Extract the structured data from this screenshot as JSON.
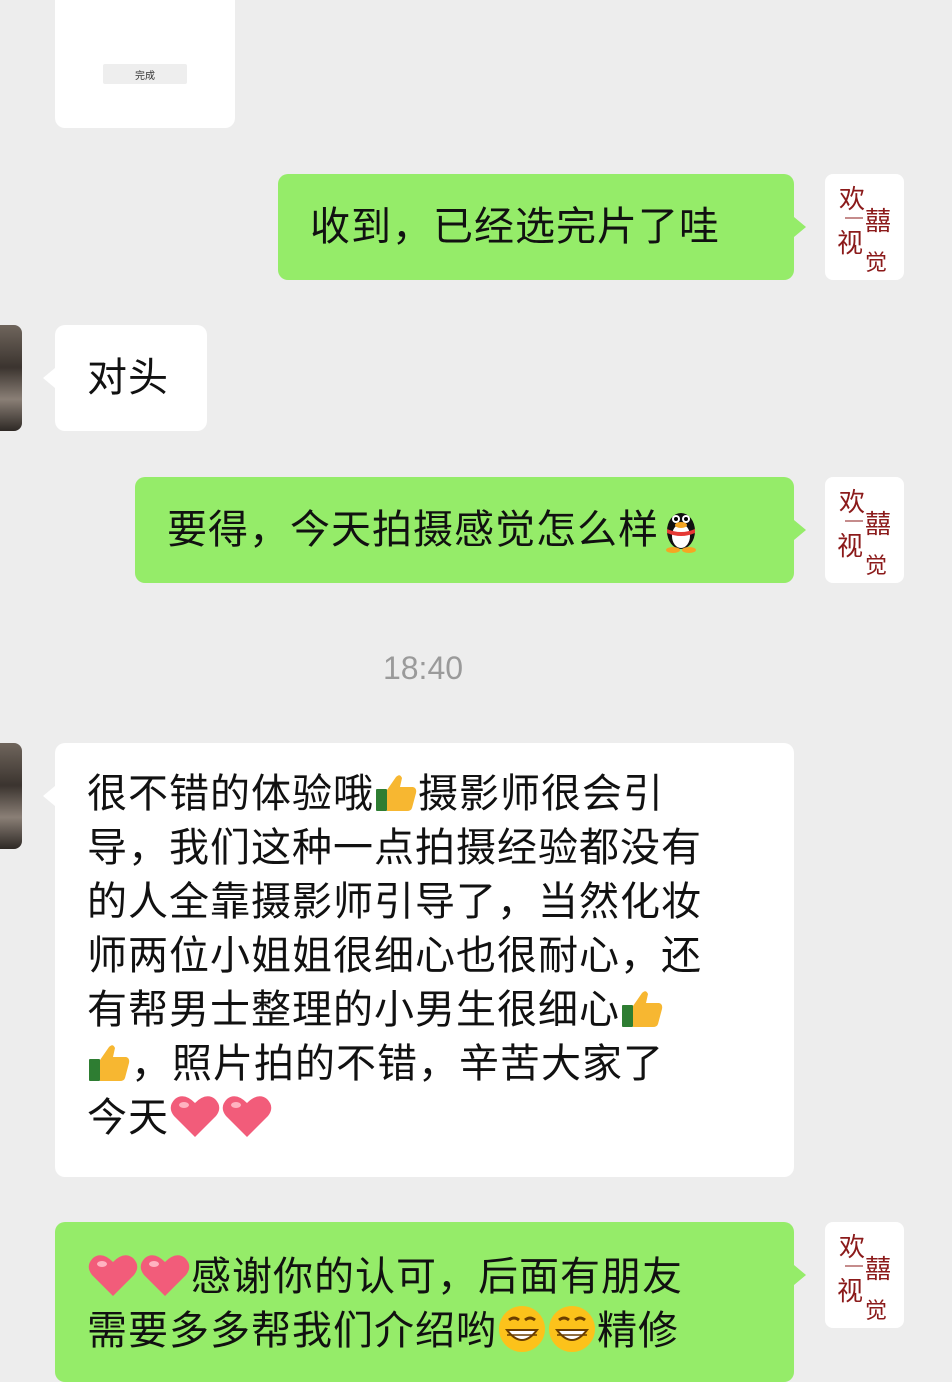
{
  "top_card": {
    "button_label": "完成"
  },
  "messages": [
    {
      "id": "m1",
      "from": "me",
      "text": "收到，已经选完片了哇"
    },
    {
      "id": "m2",
      "from": "them",
      "text": "对头"
    },
    {
      "id": "m3",
      "from": "me",
      "text": "要得，今天拍摄感觉怎么样",
      "emoji_end": "qq-penguin-icon"
    },
    {
      "id": "m4",
      "from": "them",
      "lines": [
        "很不错的体验哦",
        "摄影师很会引",
        "导，我们这种一点拍摄经验都没有",
        "的人全靠摄影师引导了，当然化妆",
        "师两位小姐姐很细心也很耐心，还",
        "有帮男士整理的小男生很细心",
        "，照片拍的不错，辛苦大家了",
        "今天"
      ]
    },
    {
      "id": "m5",
      "from": "me",
      "lines": [
        "感谢你的认可，后面有朋友",
        "需要多多帮我们介绍哟",
        "精修"
      ]
    }
  ],
  "timestamp": "18:40",
  "brand_logo": {
    "text_top": "欢",
    "text_mid": "囍",
    "text_bottom_left": "视",
    "text_bottom_right": "觉",
    "color": "#8b1a1a"
  },
  "colors": {
    "background": "#ededed",
    "sent_bubble": "#95ec69",
    "received_bubble": "#ffffff",
    "timestamp": "#9a9a9a"
  }
}
